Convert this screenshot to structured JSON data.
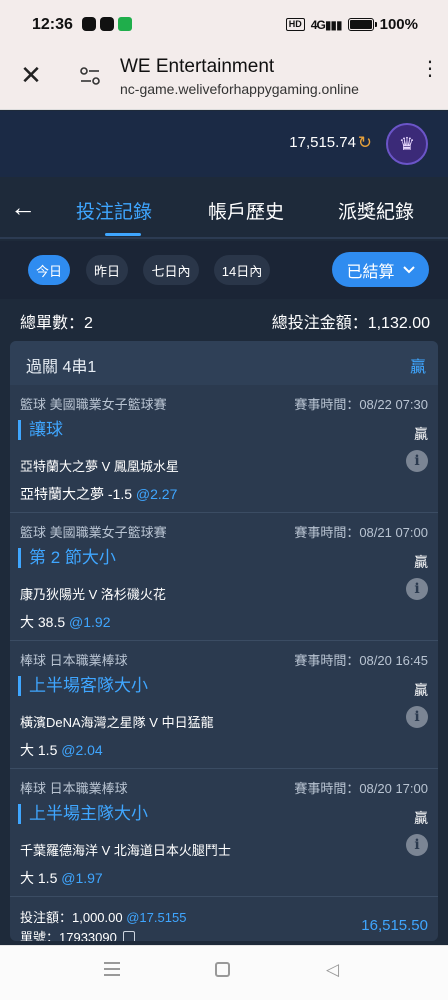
{
  "status_bar": {
    "time": "12:36",
    "network": "HD",
    "signal": "4G",
    "battery": "100%"
  },
  "browser": {
    "title": "WE Entertainment",
    "url": "nc-game.weliveforhappygaming.online"
  },
  "header": {
    "balance": "17,515.74"
  },
  "tabs": [
    {
      "label": "投注記錄",
      "active": true
    },
    {
      "label": "帳戶歷史",
      "active": false
    },
    {
      "label": "派獎紀錄",
      "active": false
    }
  ],
  "filters": {
    "periods": [
      {
        "label": "今日",
        "active": true
      },
      {
        "label": "昨日",
        "active": false
      },
      {
        "label": "七日內",
        "active": false
      },
      {
        "label": "14日內",
        "active": false
      }
    ],
    "status_label": "已結算"
  },
  "summary": {
    "count_label": "總單數：2",
    "amount_label": "總投注金額：1,132.00"
  },
  "ticket": {
    "title": "過關 4串1",
    "result": "贏",
    "legs": [
      {
        "league": "籃球 美國職業女子籃球賽",
        "time": "賽事時間：08/22 07:30",
        "market": "讓球",
        "result": "贏",
        "match": "亞特蘭大之夢 V 鳳凰城水星",
        "pick": "亞特蘭大之夢 -1.5",
        "odds": "@2.27"
      },
      {
        "league": "籃球 美國職業女子籃球賽",
        "time": "賽事時間：08/21 07:00",
        "market": "第 2 節大小",
        "result": "贏",
        "match": "康乃狄陽光 V 洛杉磯火花",
        "pick": "大 38.5",
        "odds": "@1.92"
      },
      {
        "league": "棒球 日本職業棒球",
        "time": "賽事時間：08/20 16:45",
        "market": "上半場客隊大小",
        "result": "贏",
        "match": "橫濱DeNA海灣之星隊 V 中日猛龍",
        "pick": "大 1.5",
        "odds": "@2.04"
      },
      {
        "league": "棒球 日本職業棒球",
        "time": "賽事時間：08/20 17:00",
        "market": "上半場主隊大小",
        "result": "贏",
        "match": "千葉羅德海洋 V 北海道日本火腿鬥士",
        "pick": "大 1.5",
        "odds": "@1.97"
      }
    ],
    "stake_label": "投注額：1,000.00",
    "stake_odds": "@17.5155",
    "order_label": "單號：17933090",
    "payout": "16,515.50"
  },
  "colors": {
    "accent": "#2f8cf0",
    "link": "#3fa6ff",
    "background": "#1e2a3a"
  }
}
